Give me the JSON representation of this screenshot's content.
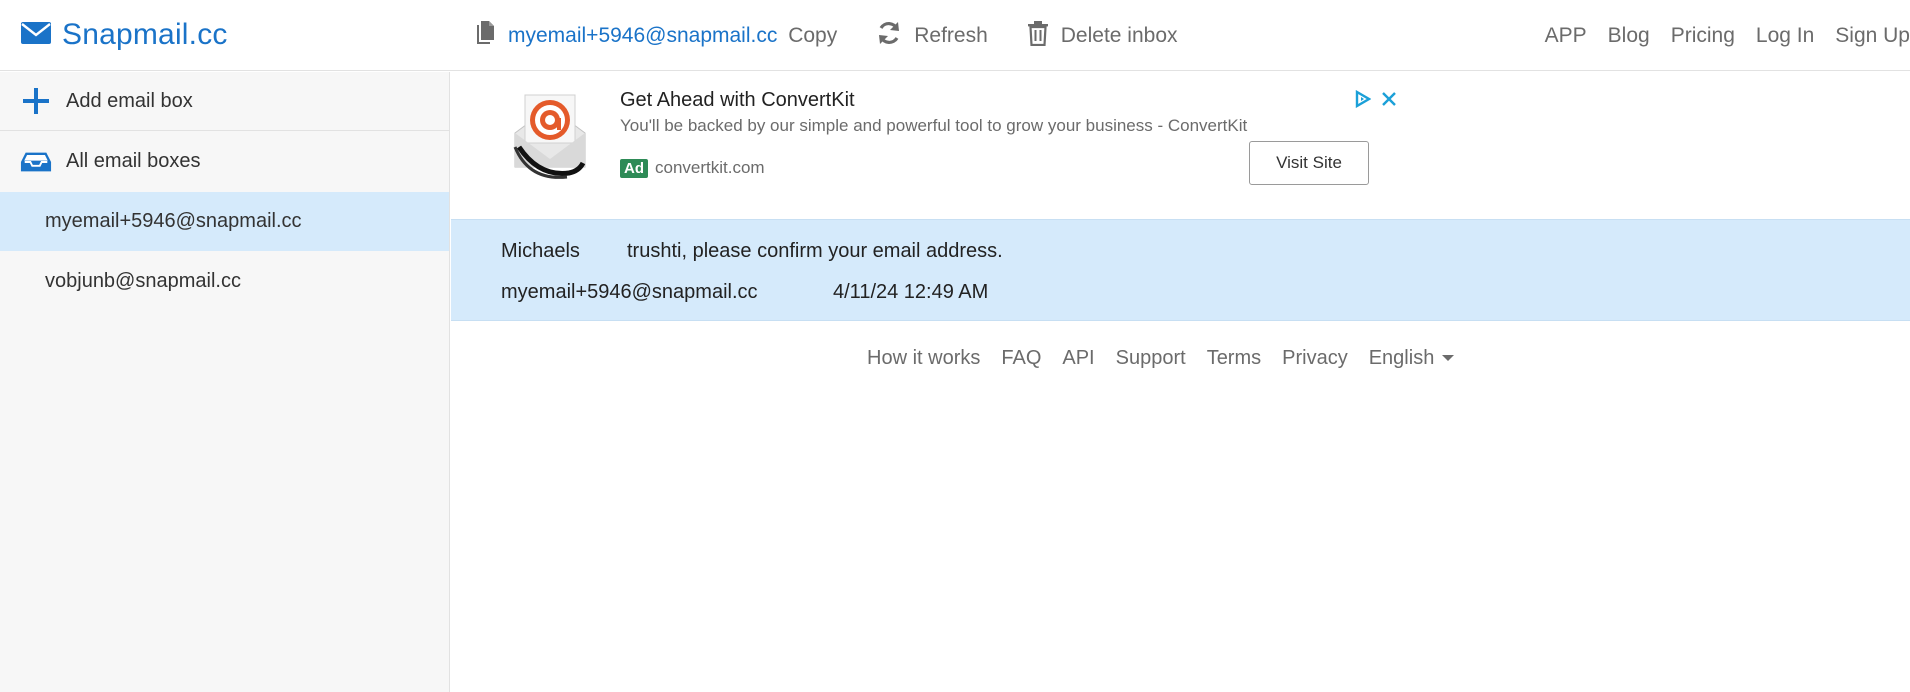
{
  "brand": {
    "name": "Snapmail.cc"
  },
  "toolbar": {
    "email": "myemail+5946@snapmail.cc",
    "copy_label": "Copy",
    "refresh_label": "Refresh",
    "delete_label": "Delete inbox"
  },
  "nav": [
    "APP",
    "Blog",
    "Pricing",
    "Log In",
    "Sign Up"
  ],
  "sidebar": {
    "add_label": "Add email box",
    "all_label": "All email boxes",
    "boxes": [
      "myemail+5946@snapmail.cc",
      "vobjunb@snapmail.cc"
    ]
  },
  "ad": {
    "title": "Get Ahead with ConvertKit",
    "description": "You'll be backed by our simple and powerful tool to grow your business - ConvertKit",
    "badge": "Ad",
    "domain": "convertkit.com",
    "button": "Visit Site"
  },
  "message": {
    "from": "Michaels",
    "subject": "trushti, please confirm your email address.",
    "to": "myemail+5946@snapmail.cc",
    "date": "4/11/24 12:49 AM"
  },
  "footer": {
    "links": [
      "How it works",
      "FAQ",
      "API",
      "Support",
      "Terms",
      "Privacy"
    ],
    "language": "English"
  },
  "colors": {
    "accent": "#1a73c8",
    "selected_bg": "#d5eafb",
    "ad_choices": "#1ba0d8",
    "ad_badge": "#2e8b57"
  }
}
